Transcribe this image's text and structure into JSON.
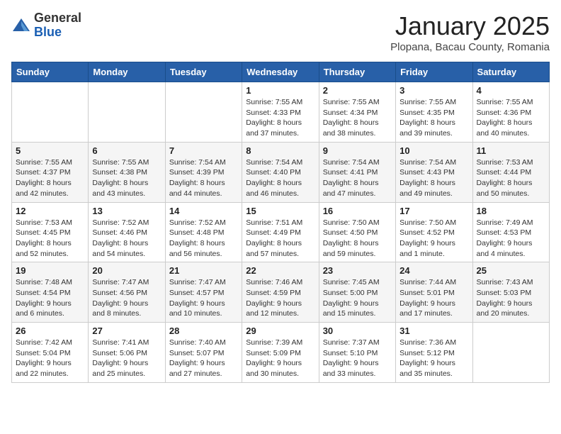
{
  "logo": {
    "general": "General",
    "blue": "Blue"
  },
  "header": {
    "month": "January 2025",
    "location": "Plopana, Bacau County, Romania"
  },
  "weekdays": [
    "Sunday",
    "Monday",
    "Tuesday",
    "Wednesday",
    "Thursday",
    "Friday",
    "Saturday"
  ],
  "weeks": [
    [
      {
        "day": "",
        "info": ""
      },
      {
        "day": "",
        "info": ""
      },
      {
        "day": "",
        "info": ""
      },
      {
        "day": "1",
        "info": "Sunrise: 7:55 AM\nSunset: 4:33 PM\nDaylight: 8 hours and 37 minutes."
      },
      {
        "day": "2",
        "info": "Sunrise: 7:55 AM\nSunset: 4:34 PM\nDaylight: 8 hours and 38 minutes."
      },
      {
        "day": "3",
        "info": "Sunrise: 7:55 AM\nSunset: 4:35 PM\nDaylight: 8 hours and 39 minutes."
      },
      {
        "day": "4",
        "info": "Sunrise: 7:55 AM\nSunset: 4:36 PM\nDaylight: 8 hours and 40 minutes."
      }
    ],
    [
      {
        "day": "5",
        "info": "Sunrise: 7:55 AM\nSunset: 4:37 PM\nDaylight: 8 hours and 42 minutes."
      },
      {
        "day": "6",
        "info": "Sunrise: 7:55 AM\nSunset: 4:38 PM\nDaylight: 8 hours and 43 minutes."
      },
      {
        "day": "7",
        "info": "Sunrise: 7:54 AM\nSunset: 4:39 PM\nDaylight: 8 hours and 44 minutes."
      },
      {
        "day": "8",
        "info": "Sunrise: 7:54 AM\nSunset: 4:40 PM\nDaylight: 8 hours and 46 minutes."
      },
      {
        "day": "9",
        "info": "Sunrise: 7:54 AM\nSunset: 4:41 PM\nDaylight: 8 hours and 47 minutes."
      },
      {
        "day": "10",
        "info": "Sunrise: 7:54 AM\nSunset: 4:43 PM\nDaylight: 8 hours and 49 minutes."
      },
      {
        "day": "11",
        "info": "Sunrise: 7:53 AM\nSunset: 4:44 PM\nDaylight: 8 hours and 50 minutes."
      }
    ],
    [
      {
        "day": "12",
        "info": "Sunrise: 7:53 AM\nSunset: 4:45 PM\nDaylight: 8 hours and 52 minutes."
      },
      {
        "day": "13",
        "info": "Sunrise: 7:52 AM\nSunset: 4:46 PM\nDaylight: 8 hours and 54 minutes."
      },
      {
        "day": "14",
        "info": "Sunrise: 7:52 AM\nSunset: 4:48 PM\nDaylight: 8 hours and 56 minutes."
      },
      {
        "day": "15",
        "info": "Sunrise: 7:51 AM\nSunset: 4:49 PM\nDaylight: 8 hours and 57 minutes."
      },
      {
        "day": "16",
        "info": "Sunrise: 7:50 AM\nSunset: 4:50 PM\nDaylight: 8 hours and 59 minutes."
      },
      {
        "day": "17",
        "info": "Sunrise: 7:50 AM\nSunset: 4:52 PM\nDaylight: 9 hours and 1 minute."
      },
      {
        "day": "18",
        "info": "Sunrise: 7:49 AM\nSunset: 4:53 PM\nDaylight: 9 hours and 4 minutes."
      }
    ],
    [
      {
        "day": "19",
        "info": "Sunrise: 7:48 AM\nSunset: 4:54 PM\nDaylight: 9 hours and 6 minutes."
      },
      {
        "day": "20",
        "info": "Sunrise: 7:47 AM\nSunset: 4:56 PM\nDaylight: 9 hours and 8 minutes."
      },
      {
        "day": "21",
        "info": "Sunrise: 7:47 AM\nSunset: 4:57 PM\nDaylight: 9 hours and 10 minutes."
      },
      {
        "day": "22",
        "info": "Sunrise: 7:46 AM\nSunset: 4:59 PM\nDaylight: 9 hours and 12 minutes."
      },
      {
        "day": "23",
        "info": "Sunrise: 7:45 AM\nSunset: 5:00 PM\nDaylight: 9 hours and 15 minutes."
      },
      {
        "day": "24",
        "info": "Sunrise: 7:44 AM\nSunset: 5:01 PM\nDaylight: 9 hours and 17 minutes."
      },
      {
        "day": "25",
        "info": "Sunrise: 7:43 AM\nSunset: 5:03 PM\nDaylight: 9 hours and 20 minutes."
      }
    ],
    [
      {
        "day": "26",
        "info": "Sunrise: 7:42 AM\nSunset: 5:04 PM\nDaylight: 9 hours and 22 minutes."
      },
      {
        "day": "27",
        "info": "Sunrise: 7:41 AM\nSunset: 5:06 PM\nDaylight: 9 hours and 25 minutes."
      },
      {
        "day": "28",
        "info": "Sunrise: 7:40 AM\nSunset: 5:07 PM\nDaylight: 9 hours and 27 minutes."
      },
      {
        "day": "29",
        "info": "Sunrise: 7:39 AM\nSunset: 5:09 PM\nDaylight: 9 hours and 30 minutes."
      },
      {
        "day": "30",
        "info": "Sunrise: 7:37 AM\nSunset: 5:10 PM\nDaylight: 9 hours and 33 minutes."
      },
      {
        "day": "31",
        "info": "Sunrise: 7:36 AM\nSunset: 5:12 PM\nDaylight: 9 hours and 35 minutes."
      },
      {
        "day": "",
        "info": ""
      }
    ]
  ]
}
